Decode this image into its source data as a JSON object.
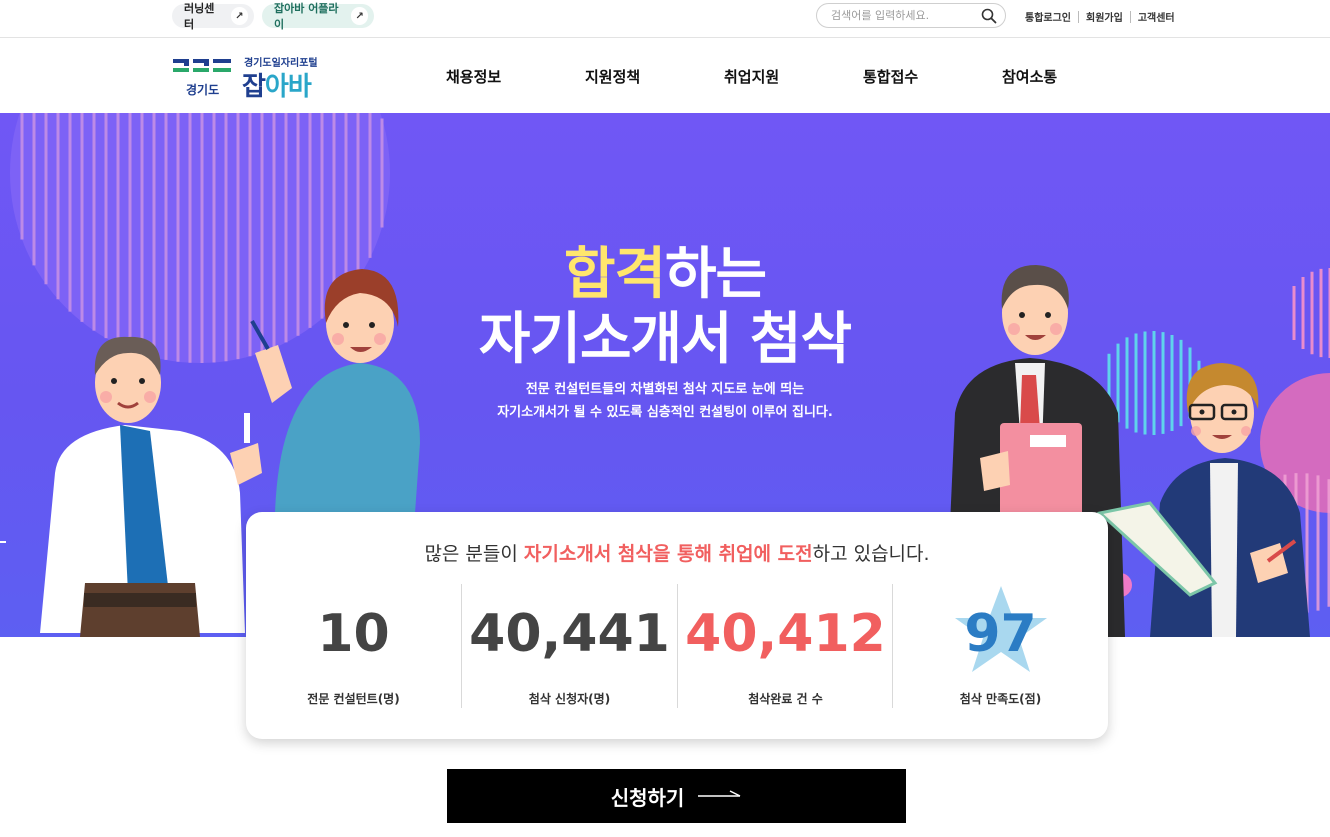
{
  "topbar": {
    "learning_center": "러닝센터",
    "jobaba_apply": "잡아바 어플라이",
    "search_placeholder": "검색어를 입력하세요.",
    "login": "통합로그인",
    "signup": "회원가입",
    "customer_center": "고객센터"
  },
  "logo": {
    "gyeonggi": "경기도",
    "portal": "경기도일자리포털",
    "brand_a": "잡",
    "brand_b": "아바"
  },
  "nav": [
    "채용정보",
    "지원정책",
    "취업지원",
    "통합접수",
    "참여소통"
  ],
  "hero": {
    "title_highlight": "합격",
    "title_rest": "하는",
    "title_line2": "자기소개서 첨삭",
    "desc_line1": "전문 컨설턴트들의 차별화된 첨삭 지도로 눈에 띄는",
    "desc_line2": "자기소개서가 될 수 있도록 심층적인 컨설팅이 이루어 집니다."
  },
  "stats": {
    "headline_pre": "많은 분들이 ",
    "headline_em": "자기소개서 첨삭을 통해 취업에 도전",
    "headline_post": "하고 있습니다.",
    "items": [
      {
        "value": "10",
        "label": "전문 컨설턴트(명)"
      },
      {
        "value": "40,441",
        "label": "첨삭 신청자(명)"
      },
      {
        "value": "40,412",
        "label": "첨삭완료 건 수"
      },
      {
        "value": "97",
        "label": "첨삭 만족도(점)"
      }
    ]
  },
  "apply_button": "신청하기",
  "colors": {
    "hero_bg": "#6a56f3",
    "accent_red": "#f15f5f",
    "accent_blue": "#2b7cc4",
    "highlight_yellow": "#ffe66d",
    "brand_navy": "#1f3f8f"
  }
}
